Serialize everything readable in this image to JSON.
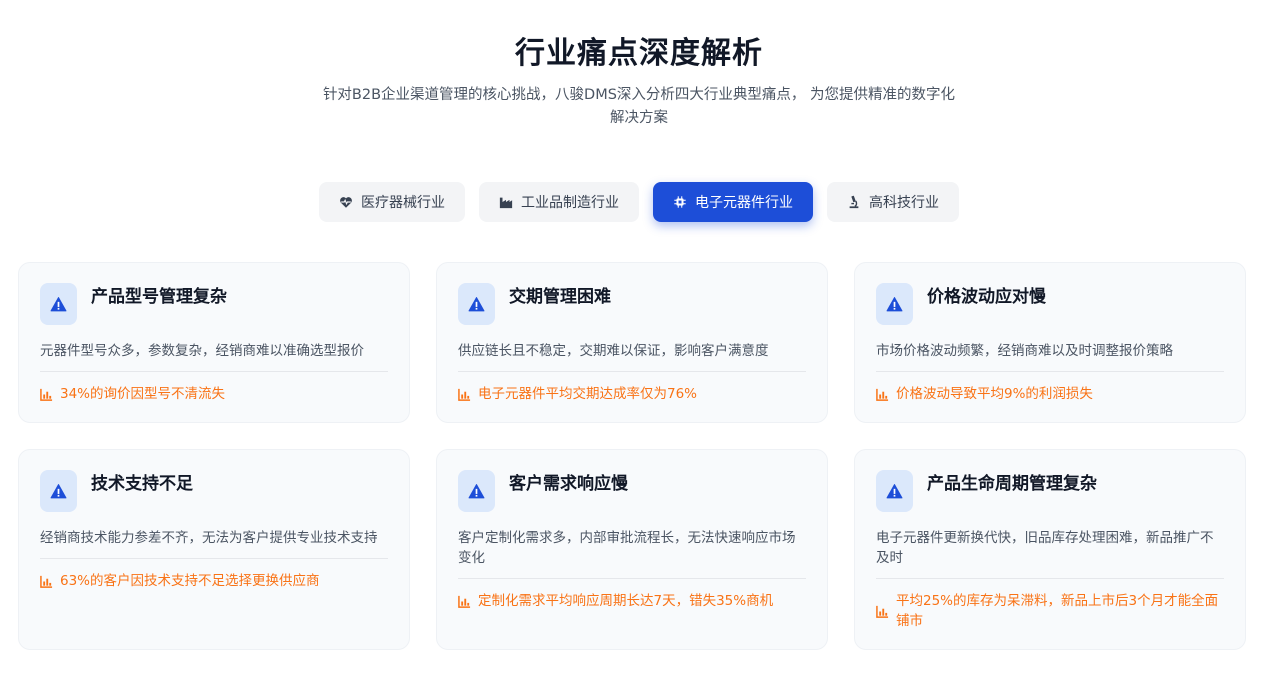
{
  "header": {
    "title": "行业痛点深度解析",
    "subtitle": "针对B2B企业渠道管理的核心挑战，八骏DMS深入分析四大行业典型痛点， 为您提供精准的数字化解决方案"
  },
  "tabs": [
    {
      "label": "医疗器械行业",
      "icon": "heartbeat-icon",
      "active": false
    },
    {
      "label": "工业品制造行业",
      "icon": "industry-icon",
      "active": false
    },
    {
      "label": "电子元器件行业",
      "icon": "microchip-icon",
      "active": true
    },
    {
      "label": "高科技行业",
      "icon": "microscope-icon",
      "active": false
    }
  ],
  "cards": [
    {
      "title": "产品型号管理复杂",
      "desc": "元器件型号众多，参数复杂，经销商难以准确选型报价",
      "stat": "34%的询价因型号不清流失"
    },
    {
      "title": "交期管理困难",
      "desc": "供应链长且不稳定，交期难以保证，影响客户满意度",
      "stat": "电子元器件平均交期达成率仅为76%"
    },
    {
      "title": "价格波动应对慢",
      "desc": "市场价格波动频繁，经销商难以及时调整报价策略",
      "stat": "价格波动导致平均9%的利润损失"
    },
    {
      "title": "技术支持不足",
      "desc": "经销商技术能力参差不齐，无法为客户提供专业技术支持",
      "stat": "63%的客户因技术支持不足选择更换供应商"
    },
    {
      "title": "客户需求响应慢",
      "desc": "客户定制化需求多，内部审批流程长，无法快速响应市场变化",
      "stat": "定制化需求平均响应周期长达7天，错失35%商机"
    },
    {
      "title": "产品生命周期管理复杂",
      "desc": "电子元器件更新换代快，旧品库存处理困难，新品推广不及时",
      "stat": "平均25%的库存为呆滞料，新品上市后3个月才能全面铺市"
    }
  ],
  "colors": {
    "accent": "#1d4ed8",
    "stat": "#f97316",
    "icon_bg": "#dbe8fb"
  },
  "icons": {
    "card_icon": "warning-triangle-icon",
    "stat_icon": "chart-bar-icon"
  }
}
